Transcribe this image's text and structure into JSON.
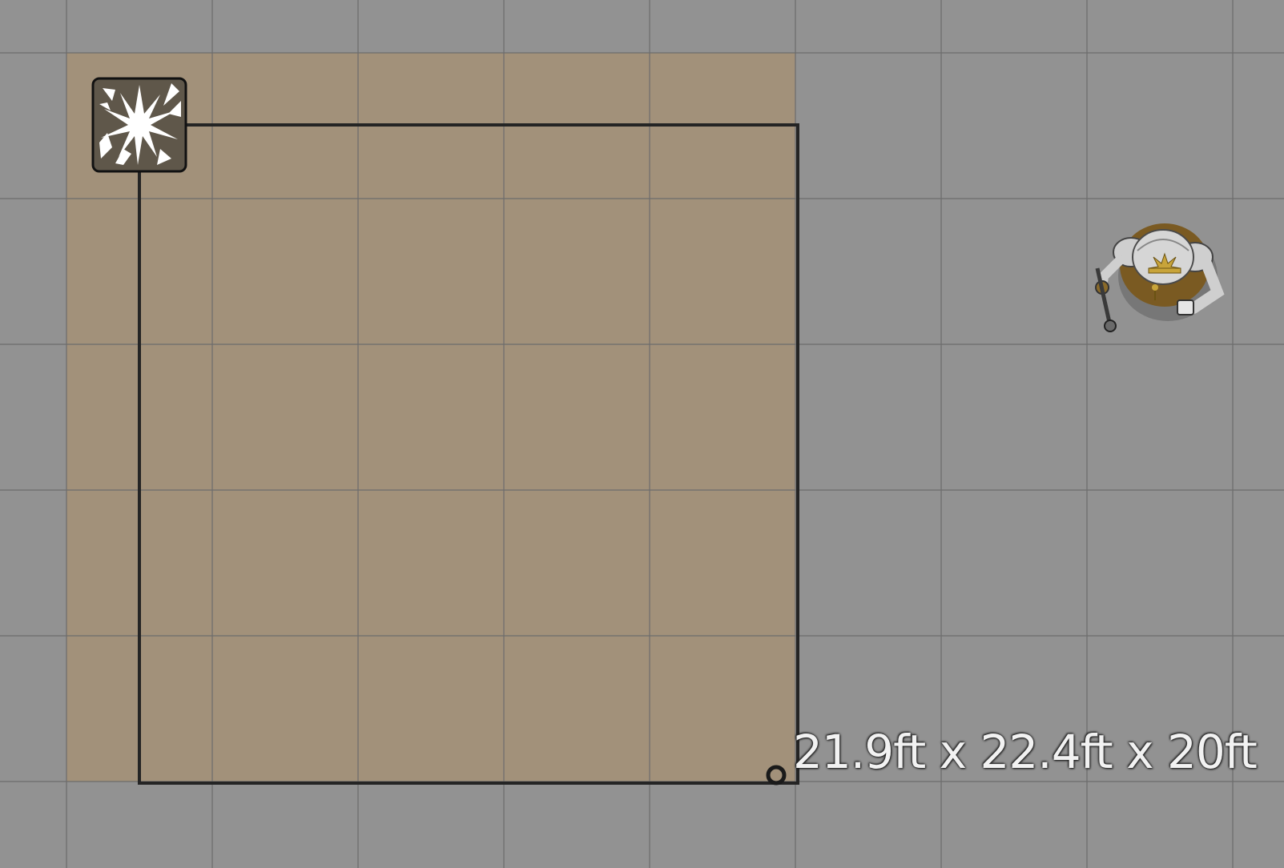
{
  "scene": {
    "background_color": "#929292",
    "grid_color": "#6f6f6f",
    "area_fill_color": "#a2917a",
    "outline_color": "#242424"
  },
  "spell_template": {
    "icon": "burst-icon",
    "icon_bg_color": "#5f574a",
    "shape": "cube"
  },
  "measurement": {
    "label": "21.9ft x 22.4ft x 20ft"
  },
  "token": {
    "name": "armored-cleric-token",
    "armor_color": "#cfcfcf",
    "accent_color": "#c8a43a"
  }
}
